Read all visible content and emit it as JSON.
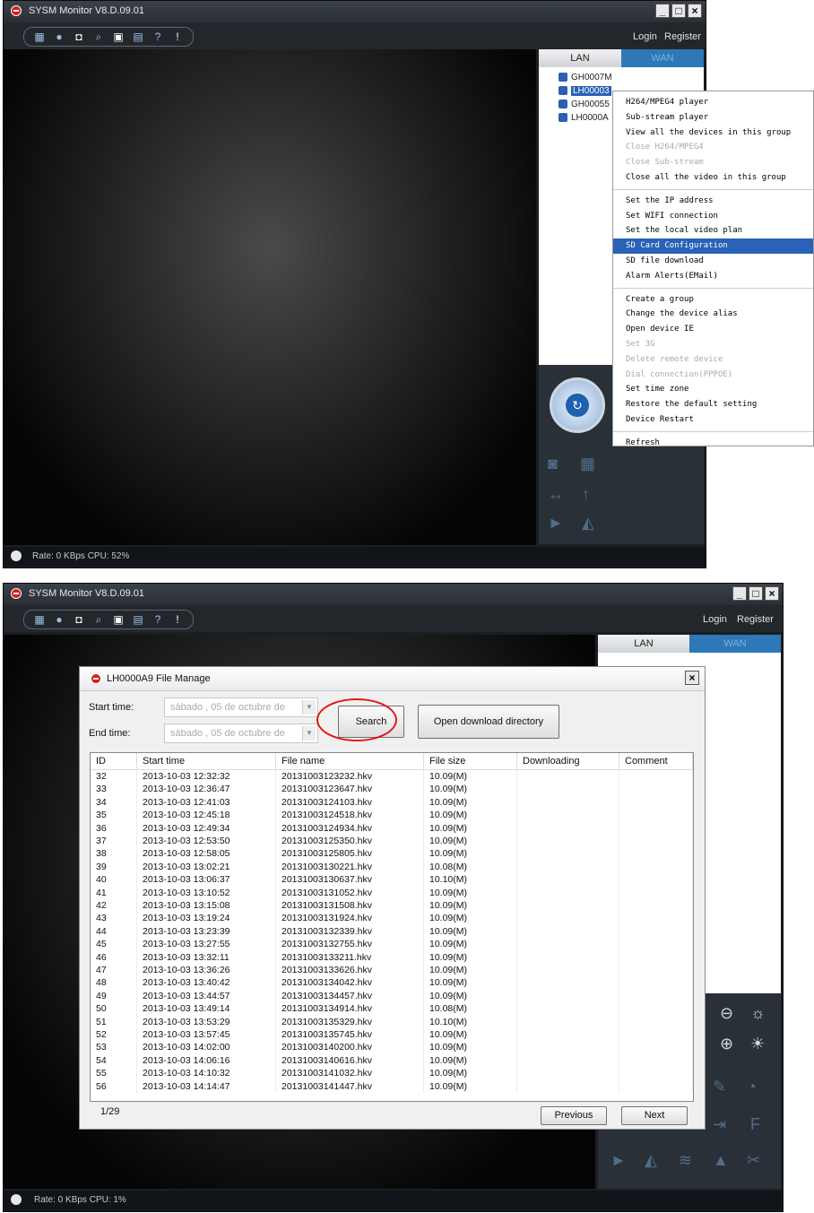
{
  "top_window": {
    "title": "SYSM Monitor  V8.D.09.01",
    "login": "Login",
    "register": "Register",
    "tabs": {
      "lan": "LAN",
      "wan": "WAN"
    },
    "devices": [
      "GH0007M",
      "LH00003",
      "GH00055",
      "LH0000A"
    ],
    "status": "Rate: 0 KBps  CPU:  52%",
    "context_menu": {
      "group1": [
        {
          "label": "H264/MPEG4 player",
          "disabled": false
        },
        {
          "label": "Sub-stream player",
          "disabled": false
        },
        {
          "label": "View all the devices in this group",
          "disabled": false
        },
        {
          "label": "Close H264/MPEG4",
          "disabled": true
        },
        {
          "label": "Close Sub-stream",
          "disabled": true
        },
        {
          "label": "Close all the video in this group",
          "disabled": false
        }
      ],
      "group2": [
        {
          "label": "Set the IP address",
          "disabled": false
        },
        {
          "label": "Set WIFI connection",
          "disabled": false
        },
        {
          "label": "Set the local video plan",
          "disabled": false
        },
        {
          "label": "SD Card Configuration",
          "disabled": false,
          "selected": true
        },
        {
          "label": "SD file download",
          "disabled": false
        },
        {
          "label": "Alarm Alerts(EMail)",
          "disabled": false
        }
      ],
      "group3": [
        {
          "label": "Create a group",
          "disabled": false
        },
        {
          "label": "Change the device alias",
          "disabled": false
        },
        {
          "label": "Open device IE",
          "disabled": false
        },
        {
          "label": "Set 3G",
          "disabled": true
        },
        {
          "label": "Delete remote device",
          "disabled": true
        },
        {
          "label": "Dial connection(PPPOE)",
          "disabled": true
        },
        {
          "label": "Set time zone",
          "disabled": false
        },
        {
          "label": "Restore the default setting",
          "disabled": false
        },
        {
          "label": "Device Restart",
          "disabled": false
        }
      ],
      "group4": [
        {
          "label": "Refresh",
          "disabled": false
        }
      ]
    }
  },
  "bottom_window": {
    "title": "SYSM Monitor  V8.D.09.01",
    "login": "Login",
    "register": "Register",
    "tabs": {
      "lan": "LAN",
      "wan": "WAN"
    },
    "status": "Rate: 0 KBps  CPU:   1%",
    "dialog": {
      "title": "LH0000A9 File Manage",
      "start_label": "Start time:",
      "end_label": "End time:",
      "start_value": "sábado , 05 de   octubre   de",
      "end_value": "sábado , 05 de   octubre   de",
      "search_button": "Search",
      "open_dir_button": "Open download directory",
      "columns": [
        "ID",
        "Start time",
        "File name",
        "File size",
        "Downloading",
        "Comment"
      ],
      "rows": [
        [
          "32",
          "2013-10-03 12:32:32",
          "20131003123232.hkv",
          "10.09(M)",
          "",
          ""
        ],
        [
          "33",
          "2013-10-03 12:36:47",
          "20131003123647.hkv",
          "10.09(M)",
          "",
          ""
        ],
        [
          "34",
          "2013-10-03 12:41:03",
          "20131003124103.hkv",
          "10.09(M)",
          "",
          ""
        ],
        [
          "35",
          "2013-10-03 12:45:18",
          "20131003124518.hkv",
          "10.09(M)",
          "",
          ""
        ],
        [
          "36",
          "2013-10-03 12:49:34",
          "20131003124934.hkv",
          "10.09(M)",
          "",
          ""
        ],
        [
          "37",
          "2013-10-03 12:53:50",
          "20131003125350.hkv",
          "10.09(M)",
          "",
          ""
        ],
        [
          "38",
          "2013-10-03 12:58:05",
          "20131003125805.hkv",
          "10.09(M)",
          "",
          ""
        ],
        [
          "39",
          "2013-10-03 13:02:21",
          "20131003130221.hkv",
          "10.08(M)",
          "",
          ""
        ],
        [
          "40",
          "2013-10-03 13:06:37",
          "20131003130637.hkv",
          "10.10(M)",
          "",
          ""
        ],
        [
          "41",
          "2013-10-03 13:10:52",
          "20131003131052.hkv",
          "10.09(M)",
          "",
          ""
        ],
        [
          "42",
          "2013-10-03 13:15:08",
          "20131003131508.hkv",
          "10.09(M)",
          "",
          ""
        ],
        [
          "43",
          "2013-10-03 13:19:24",
          "20131003131924.hkv",
          "10.09(M)",
          "",
          ""
        ],
        [
          "44",
          "2013-10-03 13:23:39",
          "20131003132339.hkv",
          "10.09(M)",
          "",
          ""
        ],
        [
          "45",
          "2013-10-03 13:27:55",
          "20131003132755.hkv",
          "10.09(M)",
          "",
          ""
        ],
        [
          "46",
          "2013-10-03 13:32:11",
          "20131003133211.hkv",
          "10.09(M)",
          "",
          ""
        ],
        [
          "47",
          "2013-10-03 13:36:26",
          "20131003133626.hkv",
          "10.09(M)",
          "",
          ""
        ],
        [
          "48",
          "2013-10-03 13:40:42",
          "20131003134042.hkv",
          "10.09(M)",
          "",
          ""
        ],
        [
          "49",
          "2013-10-03 13:44:57",
          "20131003134457.hkv",
          "10.09(M)",
          "",
          ""
        ],
        [
          "50",
          "2013-10-03 13:49:14",
          "20131003134914.hkv",
          "10.08(M)",
          "",
          ""
        ],
        [
          "51",
          "2013-10-03 13:53:29",
          "20131003135329.hkv",
          "10.10(M)",
          "",
          ""
        ],
        [
          "52",
          "2013-10-03 13:57:45",
          "20131003135745.hkv",
          "10.09(M)",
          "",
          ""
        ],
        [
          "53",
          "2013-10-03 14:02:00",
          "20131003140200.hkv",
          "10.09(M)",
          "",
          ""
        ],
        [
          "54",
          "2013-10-03 14:06:16",
          "20131003140616.hkv",
          "10.09(M)",
          "",
          ""
        ],
        [
          "55",
          "2013-10-03 14:10:32",
          "20131003141032.hkv",
          "10.09(M)",
          "",
          ""
        ],
        [
          "56",
          "2013-10-03 14:14:47",
          "20131003141447.hkv",
          "10.09(M)",
          "",
          ""
        ]
      ],
      "page": "1/29",
      "previous_button": "Previous",
      "next_button": "Next"
    }
  },
  "colors": {
    "accent": "#2962b6",
    "highlight_circle": "#e01818",
    "window_bg": "#1b1e22"
  }
}
